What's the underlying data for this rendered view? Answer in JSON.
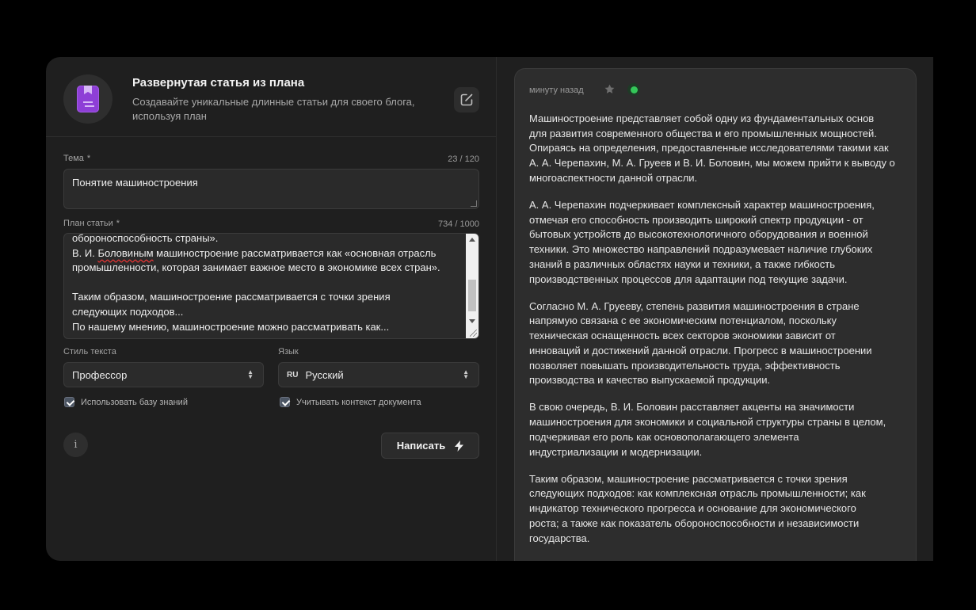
{
  "header": {
    "title": "Развернутая статья из плана",
    "subtitle": "Создавайте уникальные длинные статьи для своего блога, используя план"
  },
  "topic": {
    "label": "Тема",
    "required_mark": "*",
    "counter": "23 / 120",
    "value": "Понятие машиностроения"
  },
  "plan": {
    "label": "План статьи",
    "required_mark": "*",
    "counter": "734 / 1000",
    "lines": [
      "обороноспособность страны».",
      "В. И. Боловиным машиностроение рассматривается как «основная отрасль",
      "промышленности, которая занимает важное место в экономике всех стран».",
      "",
      "Таким образом, машиностроение рассматривается с точки зрения",
      "следующих подходов...",
      "По нашему мнению, машиностроение можно рассматривать как..."
    ],
    "line2_pre": "В. И. ",
    "line2_underlined": "Боловиным",
    "line2_post": " машиностроение рассматривается как «основная отрасль"
  },
  "style_select": {
    "label": "Стиль текста",
    "value": "Профессор"
  },
  "lang_select": {
    "label": "Язык",
    "code": "RU",
    "value": "Русский"
  },
  "checkboxes": {
    "knowledge_base": {
      "label": "Использовать базу знаний",
      "checked": true
    },
    "doc_context": {
      "label": "Учитывать контекст документа",
      "checked": true
    }
  },
  "write_button": {
    "label": "Написать"
  },
  "info_button": {
    "glyph": "i"
  },
  "result": {
    "timestamp": "минуту назад",
    "status_color": "#34c759",
    "paragraphs": [
      [
        "Машиностроение представляет собой одну из фундаментальных основ",
        "для развития современного общества и его промышленных мощностей.",
        "Опираясь на определения, предоставленные исследователями такими как",
        "А. А. Черепахин, М. А. Груеев и В. И. Боловин, мы можем прийти к выводу о",
        "многоаспектности данной отрасли."
      ],
      [
        "А. А. Черепахин подчеркивает комплексный характер машиностроения,",
        "отмечая его способность производить широкий спектр продукции - от",
        "бытовых устройств до высокотехнологичного оборудования и военной",
        "техники. Это множество направлений подразумевает наличие глубоких",
        "знаний в различных областях науки и техники, а также гибкость",
        "производственных процессов для адаптации под текущие задачи."
      ],
      [
        "Согласно М. А. Груееву, степень развития машиностроения в стране",
        "напрямую связана с ее экономическим потенциалом, поскольку",
        "техническая оснащенность всех секторов экономики зависит от",
        "инноваций и достижений данной отрасли. Прогресс в машиностроении",
        "позволяет повышать производительность труда, эффективность",
        "производства и качество выпускаемой продукции."
      ],
      [
        "В свою очередь, В. И. Боловин расставляет акценты на значимости",
        "машиностроения для экономики и социальной структуры страны в целом,",
        "подчеркивая его роль как основополагающего элемента",
        "индустриализации и модернизации."
      ],
      [
        "Таким образом, машиностроение рассматривается с точки зрения",
        "следующих подходов: как комплексная отрасль промышленности; как",
        "индикатор технического прогресса и основание для экономического",
        "роста; а также как показатель обороноспособности и независимости",
        "государства."
      ]
    ]
  }
}
